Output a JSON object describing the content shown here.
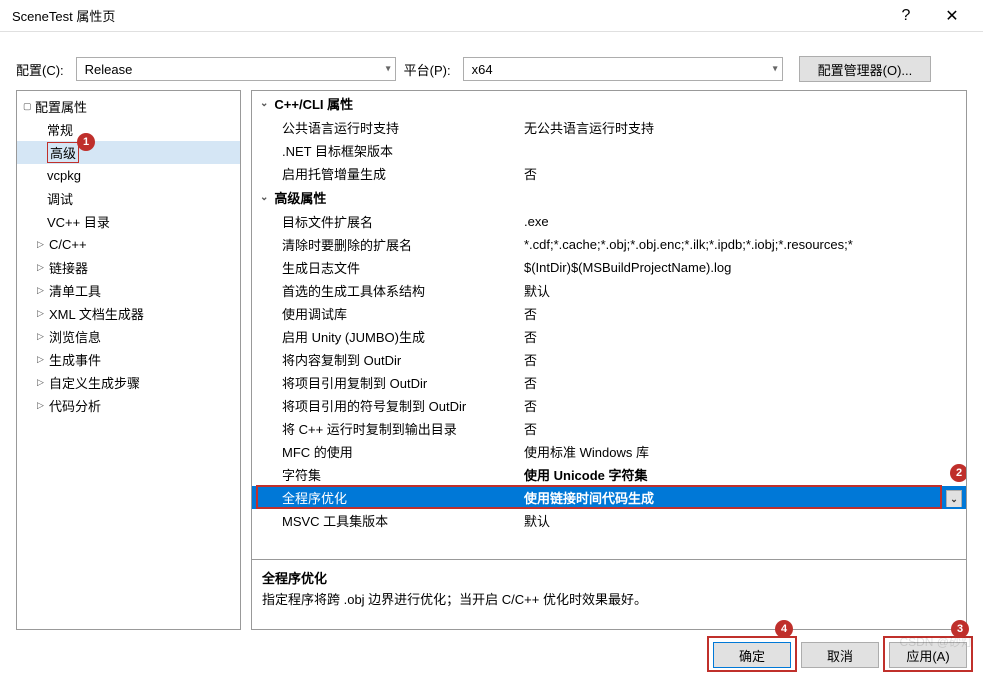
{
  "window": {
    "title": "SceneTest 属性页"
  },
  "toolbar": {
    "config_label": "配置(C):",
    "config_value": "Release",
    "platform_label": "平台(P):",
    "platform_value": "x64",
    "manager_btn": "配置管理器(O)..."
  },
  "tree": {
    "root": "配置属性",
    "items": [
      {
        "label": "常规"
      },
      {
        "label": "高级",
        "selected": true
      },
      {
        "label": "vcpkg"
      },
      {
        "label": "调试"
      },
      {
        "label": "VC++ 目录"
      },
      {
        "label": "C/C++",
        "children": true
      },
      {
        "label": "链接器",
        "children": true
      },
      {
        "label": "清单工具",
        "children": true
      },
      {
        "label": "XML 文档生成器",
        "children": true
      },
      {
        "label": "浏览信息",
        "children": true
      },
      {
        "label": "生成事件",
        "children": true
      },
      {
        "label": "自定义生成步骤",
        "children": true
      },
      {
        "label": "代码分析",
        "children": true
      }
    ]
  },
  "groups": [
    {
      "title": "C++/CLI 属性",
      "props": [
        {
          "label": "公共语言运行时支持",
          "value": "无公共语言运行时支持"
        },
        {
          "label": ".NET 目标框架版本",
          "value": ""
        },
        {
          "label": "启用托管增量生成",
          "value": "否"
        }
      ]
    },
    {
      "title": "高级属性",
      "props": [
        {
          "label": "目标文件扩展名",
          "value": ".exe"
        },
        {
          "label": "清除时要删除的扩展名",
          "value": "*.cdf;*.cache;*.obj;*.obj.enc;*.ilk;*.ipdb;*.iobj;*.resources;*"
        },
        {
          "label": "生成日志文件",
          "value": "$(IntDir)$(MSBuildProjectName).log"
        },
        {
          "label": "首选的生成工具体系结构",
          "value": "默认"
        },
        {
          "label": "使用调试库",
          "value": "否"
        },
        {
          "label": "启用 Unity (JUMBO)生成",
          "value": "否"
        },
        {
          "label": "将内容复制到 OutDir",
          "value": "否"
        },
        {
          "label": "将项目引用复制到 OutDir",
          "value": "否"
        },
        {
          "label": "将项目引用的符号复制到 OutDir",
          "value": "否"
        },
        {
          "label": "将 C++ 运行时复制到输出目录",
          "value": "否"
        },
        {
          "label": "MFC 的使用",
          "value": "使用标准 Windows 库"
        },
        {
          "label": "字符集",
          "value": "使用 Unicode 字符集",
          "bold": true
        },
        {
          "label": "全程序优化",
          "value": "使用链接时间代码生成",
          "selected": true
        },
        {
          "label": "MSVC 工具集版本",
          "value": "默认"
        }
      ]
    }
  ],
  "description": {
    "title": "全程序优化",
    "body": "指定程序将跨 .obj 边界进行优化；当开启 C/C++ 优化时效果最好。"
  },
  "buttons": {
    "ok": "确定",
    "cancel": "取消",
    "apply": "应用(A)"
  },
  "badges": {
    "b1": "1",
    "b2": "2",
    "b3": "3",
    "b4": "4"
  },
  "watermark": "CSDN @砂灯"
}
